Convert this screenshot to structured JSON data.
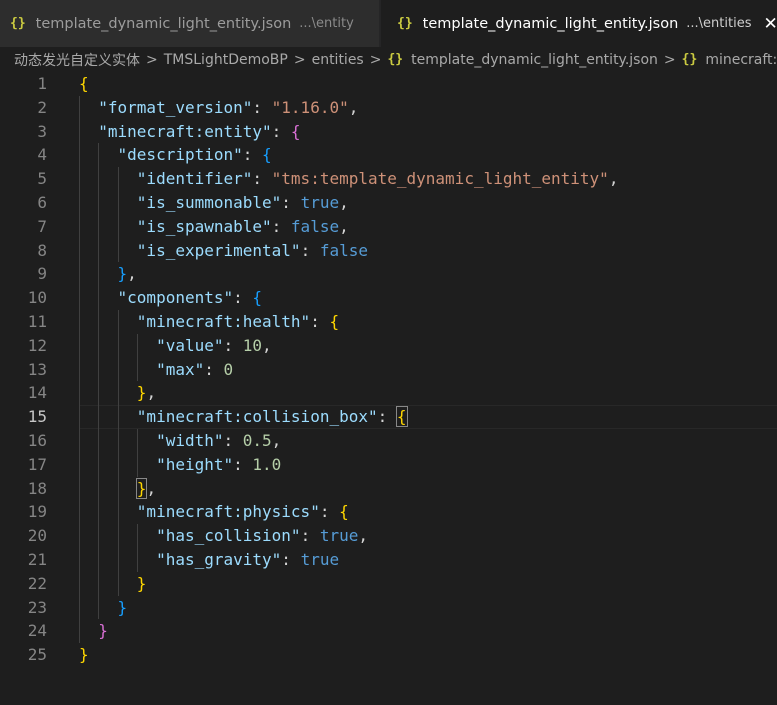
{
  "tabs": [
    {
      "icon": "{}",
      "title": "template_dynamic_light_entity.json",
      "desc": "...\\entity",
      "active": false
    },
    {
      "icon": "{}",
      "title": "template_dynamic_light_entity.json",
      "desc": "...\\entities",
      "active": true,
      "close": "✕"
    }
  ],
  "breadcrumb": {
    "items": [
      "动态发光自定义实体",
      "TMSLightDemoBP",
      "entities"
    ],
    "file_icon": "{}",
    "file": "template_dynamic_light_entity.json",
    "symbol_icon": "{}",
    "symbol": "minecraft:entity",
    "separator": ">"
  },
  "editor": {
    "active_line": 15,
    "lines": [
      {
        "n": "1",
        "t": [
          [
            "{",
            "br1"
          ]
        ]
      },
      {
        "n": "2",
        "t": [
          [
            "  ",
            ""
          ],
          [
            "\"format_version\"",
            "k"
          ],
          [
            ": ",
            "p"
          ],
          [
            "\"1.16.0\"",
            "s"
          ],
          [
            ",",
            "p"
          ]
        ]
      },
      {
        "n": "3",
        "t": [
          [
            "  ",
            ""
          ],
          [
            "\"minecraft:entity\"",
            "k"
          ],
          [
            ": ",
            "p"
          ],
          [
            "{",
            "br2"
          ]
        ]
      },
      {
        "n": "4",
        "t": [
          [
            "    ",
            ""
          ],
          [
            "\"description\"",
            "k"
          ],
          [
            ": ",
            "p"
          ],
          [
            "{",
            "br3"
          ]
        ]
      },
      {
        "n": "5",
        "t": [
          [
            "      ",
            ""
          ],
          [
            "\"identifier\"",
            "k"
          ],
          [
            ": ",
            "p"
          ],
          [
            "\"tms:template_dynamic_light_entity\"",
            "s"
          ],
          [
            ",",
            "p"
          ]
        ]
      },
      {
        "n": "6",
        "t": [
          [
            "      ",
            ""
          ],
          [
            "\"is_summonable\"",
            "k"
          ],
          [
            ": ",
            "p"
          ],
          [
            "true",
            "b"
          ],
          [
            ",",
            "p"
          ]
        ]
      },
      {
        "n": "7",
        "t": [
          [
            "      ",
            ""
          ],
          [
            "\"is_spawnable\"",
            "k"
          ],
          [
            ": ",
            "p"
          ],
          [
            "false",
            "b"
          ],
          [
            ",",
            "p"
          ]
        ]
      },
      {
        "n": "8",
        "t": [
          [
            "      ",
            ""
          ],
          [
            "\"is_experimental\"",
            "k"
          ],
          [
            ": ",
            "p"
          ],
          [
            "false",
            "b"
          ]
        ]
      },
      {
        "n": "9",
        "t": [
          [
            "    ",
            ""
          ],
          [
            "}",
            "br3"
          ],
          [
            ",",
            "p"
          ]
        ]
      },
      {
        "n": "10",
        "t": [
          [
            "    ",
            ""
          ],
          [
            "\"components\"",
            "k"
          ],
          [
            ": ",
            "p"
          ],
          [
            "{",
            "br3"
          ]
        ]
      },
      {
        "n": "11",
        "t": [
          [
            "      ",
            ""
          ],
          [
            "\"minecraft:health\"",
            "k"
          ],
          [
            ": ",
            "p"
          ],
          [
            "{",
            "br1"
          ]
        ]
      },
      {
        "n": "12",
        "t": [
          [
            "        ",
            ""
          ],
          [
            "\"value\"",
            "k"
          ],
          [
            ": ",
            "p"
          ],
          [
            "10",
            "n"
          ],
          [
            ",",
            "p"
          ]
        ]
      },
      {
        "n": "13",
        "t": [
          [
            "        ",
            ""
          ],
          [
            "\"max\"",
            "k"
          ],
          [
            ": ",
            "p"
          ],
          [
            "0",
            "n"
          ]
        ]
      },
      {
        "n": "14",
        "t": [
          [
            "      ",
            ""
          ],
          [
            "}",
            "br1"
          ],
          [
            ",",
            "p"
          ]
        ]
      },
      {
        "n": "15",
        "t": [
          [
            "      ",
            ""
          ],
          [
            "\"minecraft:collision_box\"",
            "k"
          ],
          [
            ": ",
            "p"
          ],
          [
            "{",
            "br1 match"
          ]
        ]
      },
      {
        "n": "16",
        "t": [
          [
            "        ",
            ""
          ],
          [
            "\"width\"",
            "k"
          ],
          [
            ": ",
            "p"
          ],
          [
            "0.5",
            "n"
          ],
          [
            ",",
            "p"
          ]
        ]
      },
      {
        "n": "17",
        "t": [
          [
            "        ",
            ""
          ],
          [
            "\"height\"",
            "k"
          ],
          [
            ": ",
            "p"
          ],
          [
            "1.0",
            "n"
          ]
        ]
      },
      {
        "n": "18",
        "t": [
          [
            "      ",
            ""
          ],
          [
            "}",
            "br1 match"
          ],
          [
            ",",
            "p"
          ]
        ]
      },
      {
        "n": "19",
        "t": [
          [
            "      ",
            ""
          ],
          [
            "\"minecraft:physics\"",
            "k"
          ],
          [
            ": ",
            "p"
          ],
          [
            "{",
            "br1"
          ]
        ]
      },
      {
        "n": "20",
        "t": [
          [
            "        ",
            ""
          ],
          [
            "\"has_collision\"",
            "k"
          ],
          [
            ": ",
            "p"
          ],
          [
            "true",
            "b"
          ],
          [
            ",",
            "p"
          ]
        ]
      },
      {
        "n": "21",
        "t": [
          [
            "        ",
            ""
          ],
          [
            "\"has_gravity\"",
            "k"
          ],
          [
            ": ",
            "p"
          ],
          [
            "true",
            "b"
          ]
        ]
      },
      {
        "n": "22",
        "t": [
          [
            "      ",
            ""
          ],
          [
            "}",
            "br1"
          ]
        ]
      },
      {
        "n": "23",
        "t": [
          [
            "    ",
            ""
          ],
          [
            "}",
            "br3"
          ]
        ]
      },
      {
        "n": "24",
        "t": [
          [
            "  ",
            ""
          ],
          [
            "}",
            "br2"
          ]
        ]
      },
      {
        "n": "25",
        "t": [
          [
            "}",
            "br1"
          ]
        ]
      }
    ]
  }
}
